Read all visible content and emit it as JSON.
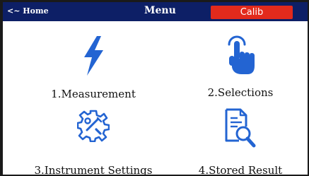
{
  "topbar": {
    "home_label": "<~ Home",
    "title": "Menu",
    "calib_label": "Calib"
  },
  "menu": {
    "items": [
      {
        "label": "1.Measurement",
        "icon": "lightning-bolt-icon"
      },
      {
        "label": "2.Selections",
        "icon": "tap-hand-icon"
      },
      {
        "label": "3.Instrument Settings",
        "icon": "gear-tools-icon"
      },
      {
        "label": "4.Stored Result",
        "icon": "document-search-icon"
      }
    ]
  },
  "colors": {
    "topbar": "#0d1f66",
    "calib": "#e22a1c",
    "icon": "#2364d2"
  }
}
